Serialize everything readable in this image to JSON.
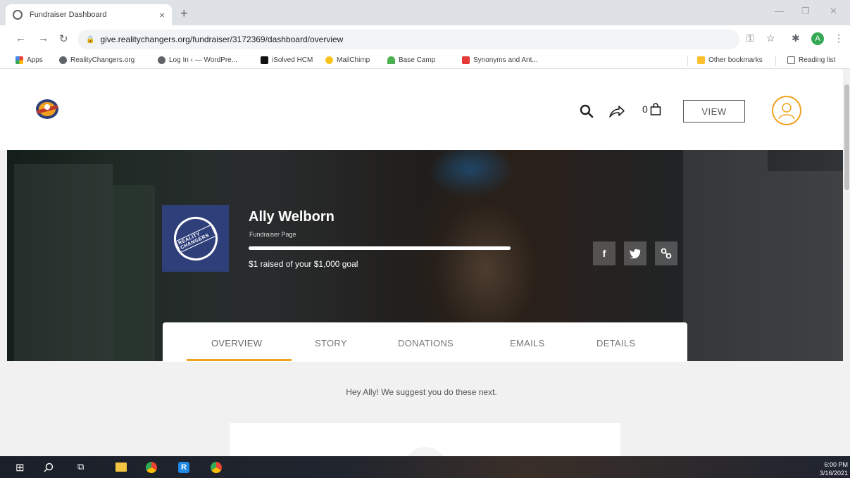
{
  "browser": {
    "tab_title": "Fundraiser Dashboard",
    "tab_close": "×",
    "new_tab": "+",
    "url": "give.realitychangers.org/fundraiser/3172369/dashboard/overview",
    "profile_initial": "A",
    "bookmarks": [
      {
        "label": "Apps",
        "color": "#ea4335"
      },
      {
        "label": "RealityChangers.org",
        "color": "#5f6368"
      },
      {
        "label": "Log In ‹ — WordPre...",
        "color": "#5f6368"
      },
      {
        "label": "iSolved HCM",
        "color": "#111111"
      },
      {
        "label": "MailChimp",
        "color": "#f7c41f"
      },
      {
        "label": "Base Camp",
        "color": "#4caf50"
      },
      {
        "label": "Synonyms and Ant...",
        "color": "#e53935"
      }
    ],
    "other_bookmarks": "Other bookmarks",
    "reading_list": "Reading list"
  },
  "header": {
    "cart_count": "0",
    "view_label": "VIEW"
  },
  "hero": {
    "name": "Ally Welborn",
    "subtitle": "Fundraiser Page",
    "goal_text": "$1 raised of your $1,000 goal",
    "progress_fraction": 0.001,
    "seal_text": "REALITY CHANGERS",
    "social": [
      {
        "icon": "facebook-icon",
        "glyph": "f"
      },
      {
        "icon": "twitter-icon",
        "glyph": "🐦"
      },
      {
        "icon": "link-icon",
        "glyph": "%"
      }
    ]
  },
  "tabs": [
    "OVERVIEW",
    "STORY",
    "DONATIONS",
    "EMAILS",
    "DETAILS"
  ],
  "active_tab": "OVERVIEW",
  "main": {
    "suggestion": "Hey Ally! We suggest you do these next."
  },
  "taskbar": {
    "time": "6:00 PM",
    "date": "3/16/2021"
  },
  "colors": {
    "accent": "#f0a21e",
    "hero_name": "#ffffff"
  }
}
